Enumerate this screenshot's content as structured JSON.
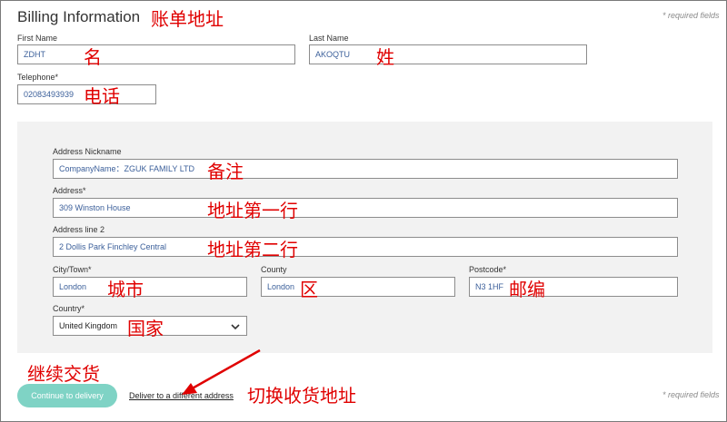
{
  "header": {
    "title": "Billing Information",
    "title_annotation": "账单地址",
    "required_note": "* required fields"
  },
  "first_name": {
    "label": "First Name",
    "value": "ZDHT",
    "annotation": "名"
  },
  "last_name": {
    "label": "Last Name",
    "value": "AKOQTU",
    "annotation": "姓"
  },
  "telephone": {
    "label": "Telephone*",
    "value": "02083493939",
    "annotation": "电话"
  },
  "address_nickname": {
    "label": "Address Nickname",
    "value": "CompanyName：ZGUK FAMILY LTD",
    "annotation": "备注"
  },
  "address1": {
    "label": "Address*",
    "value": "309 Winston House",
    "annotation": "地址第一行"
  },
  "address2": {
    "label": "Address line 2",
    "value": "2 Dollis Park Finchley Central",
    "annotation": "地址第二行"
  },
  "city": {
    "label": "City/Town*",
    "value": "London",
    "annotation": "城市"
  },
  "county": {
    "label": "County",
    "value": "London",
    "annotation": "区"
  },
  "postcode": {
    "label": "Postcode*",
    "value": "N3 1HF",
    "annotation": "邮编"
  },
  "country": {
    "label": "Country*",
    "value": "United Kingdom",
    "annotation": "国家"
  },
  "footer": {
    "continue_label": "Continue to delivery",
    "continue_annotation": "继续交货",
    "deliver_link": "Deliver to a different address",
    "deliver_annotation": "切换收货地址",
    "required_note": "* required fields"
  },
  "colors": {
    "annotation": "#e00000",
    "button": "#7fd3c5",
    "field_text": "#3b5f9a",
    "panel": "#f2f2f2"
  }
}
